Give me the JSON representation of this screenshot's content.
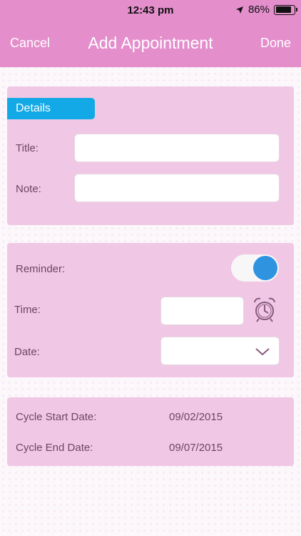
{
  "status_bar": {
    "time": "12:43 pm",
    "battery": "86%",
    "battery_level": 0.86
  },
  "nav": {
    "cancel": "Cancel",
    "title": "Add Appointment",
    "done": "Done"
  },
  "details": {
    "tab": "Details",
    "title_label": "Title:",
    "title_value": "",
    "note_label": "Note:",
    "note_value": ""
  },
  "reminder": {
    "label": "Reminder:",
    "enabled": true,
    "time_label": "Time:",
    "time_value": "",
    "date_label": "Date:",
    "date_value": ""
  },
  "cycle": {
    "start_label": "Cycle Start Date:",
    "start_value": "09/02/2015",
    "end_label": "Cycle End Date:",
    "end_value": "09/07/2015"
  },
  "icons": {
    "location": "location-arrow-icon",
    "battery": "battery-icon",
    "alarm": "alarm-clock-icon",
    "dropdown": "chevron-down-icon"
  },
  "colors": {
    "header": "#e48ecc",
    "card": "#f0c8e5",
    "tab": "#12a9e6",
    "toggle_on": "#2f93e0"
  }
}
